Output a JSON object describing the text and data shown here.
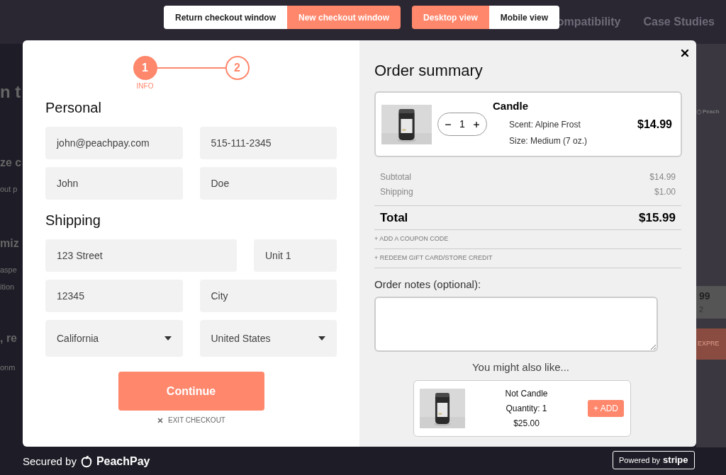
{
  "top_toggles": [
    {
      "options": [
        {
          "label": "Return checkout window",
          "selected": false
        },
        {
          "label": "New checkout window",
          "selected": true
        }
      ]
    },
    {
      "options": [
        {
          "label": "Desktop view",
          "selected": true
        },
        {
          "label": "Mobile view",
          "selected": false
        }
      ]
    }
  ],
  "background": {
    "nav": [
      "ompatibility",
      "Case Studies"
    ],
    "left_fragments": [
      {
        "text": "n t",
        "kind": "heading"
      },
      {
        "text": "ze c",
        "kind": "subheading"
      },
      {
        "text": "out p",
        "kind": "body"
      },
      {
        "text": "miz",
        "kind": "subheading"
      },
      {
        "text": "aspe",
        "kind": "body"
      },
      {
        "text": "ition",
        "kind": "body"
      },
      {
        "text": ", re",
        "kind": "subheading"
      },
      {
        "text": "onm",
        "kind": "body"
      }
    ],
    "right_fragments": {
      "logo": "Peach",
      "price": "99",
      "count": "2",
      "button": "EXPRE"
    }
  },
  "steps": [
    {
      "label": "1",
      "caption": "INFO",
      "selected": true
    },
    {
      "label": "2",
      "selected": false
    }
  ],
  "sections": [
    {
      "title": "Personal",
      "rows": [
        [
          {
            "value": "john@peachpay.com",
            "kind": "text"
          },
          {
            "value": "515-111-2345",
            "kind": "text"
          }
        ],
        [
          {
            "value": "John",
            "kind": "text"
          },
          {
            "value": "Doe",
            "kind": "text"
          }
        ]
      ]
    },
    {
      "title": "Shipping",
      "rows": [
        [
          {
            "value": "123 Street",
            "kind": "wide"
          },
          {
            "value": "Unit 1",
            "kind": "text"
          }
        ],
        [
          {
            "value": "12345",
            "kind": "text"
          },
          {
            "value": "City",
            "kind": "text"
          }
        ],
        [
          {
            "value": "California",
            "kind": "select"
          },
          {
            "value": "United States",
            "kind": "select"
          }
        ]
      ]
    }
  ],
  "continue_button": "Continue",
  "exit_link": "EXIT CHECKOUT",
  "summary": {
    "title": "Order summary",
    "item": {
      "quantity": "1",
      "name": "Candle",
      "options": [
        "Scent: Alpine Frost",
        "Size: Medium (7 oz.)"
      ],
      "price": "$14.99"
    },
    "lines": [
      {
        "label": "Subtotal",
        "value": "$14.99"
      },
      {
        "label": "Shipping",
        "value": "$1.00"
      }
    ],
    "total": {
      "label": "Total",
      "value": "$15.99"
    },
    "links": [
      "+ ADD A COUPON CODE",
      "+ REDEEM GIFT CARD/STORE CREDIT"
    ],
    "notes_label": "Order notes (optional):",
    "upsell_title": "You might also like...",
    "upsell": {
      "name": "Not Candle",
      "quantity": "Quantity: 1",
      "price": "$25.00",
      "button": "+ ADD"
    }
  },
  "footer": {
    "secured": "Secured by",
    "brand": "PeachPay",
    "powered": "Powered by",
    "stripe": "stripe"
  }
}
